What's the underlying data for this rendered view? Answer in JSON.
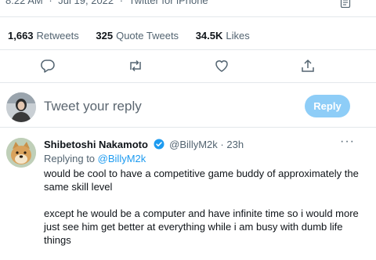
{
  "tweet_meta": {
    "time": "8:22 AM",
    "date": "Jul 19, 2022",
    "source": "Twitter for iPhone"
  },
  "stats": {
    "retweets_count": "1,663",
    "retweets_label": "Retweets",
    "quote_count": "325",
    "quote_label": "Quote Tweets",
    "likes_count": "34.5K",
    "likes_label": "Likes"
  },
  "actions": [
    "reply-icon",
    "retweet-icon",
    "like-icon",
    "share-icon"
  ],
  "composer": {
    "placeholder": "Tweet your reply",
    "reply_button": "Reply"
  },
  "reply_tweet": {
    "name": "Shibetoshi Nakamoto",
    "handle": "@BillyM2k",
    "separator": "·",
    "time": "23h",
    "replying_prefix": "Replying to",
    "replying_to": "@BillyM2k",
    "paragraph_1": "would be cool to have a competitive game buddy of approximately the same skill level",
    "paragraph_2": "except he would be a computer and have infinite time so i would more just see him get better at everything while i am busy with dumb life things"
  },
  "colors": {
    "accent": "#1d9bf0",
    "reply_button_disabled": "#8ecdf7",
    "secondary_text": "#536471",
    "divider": "#e3e8eb"
  }
}
